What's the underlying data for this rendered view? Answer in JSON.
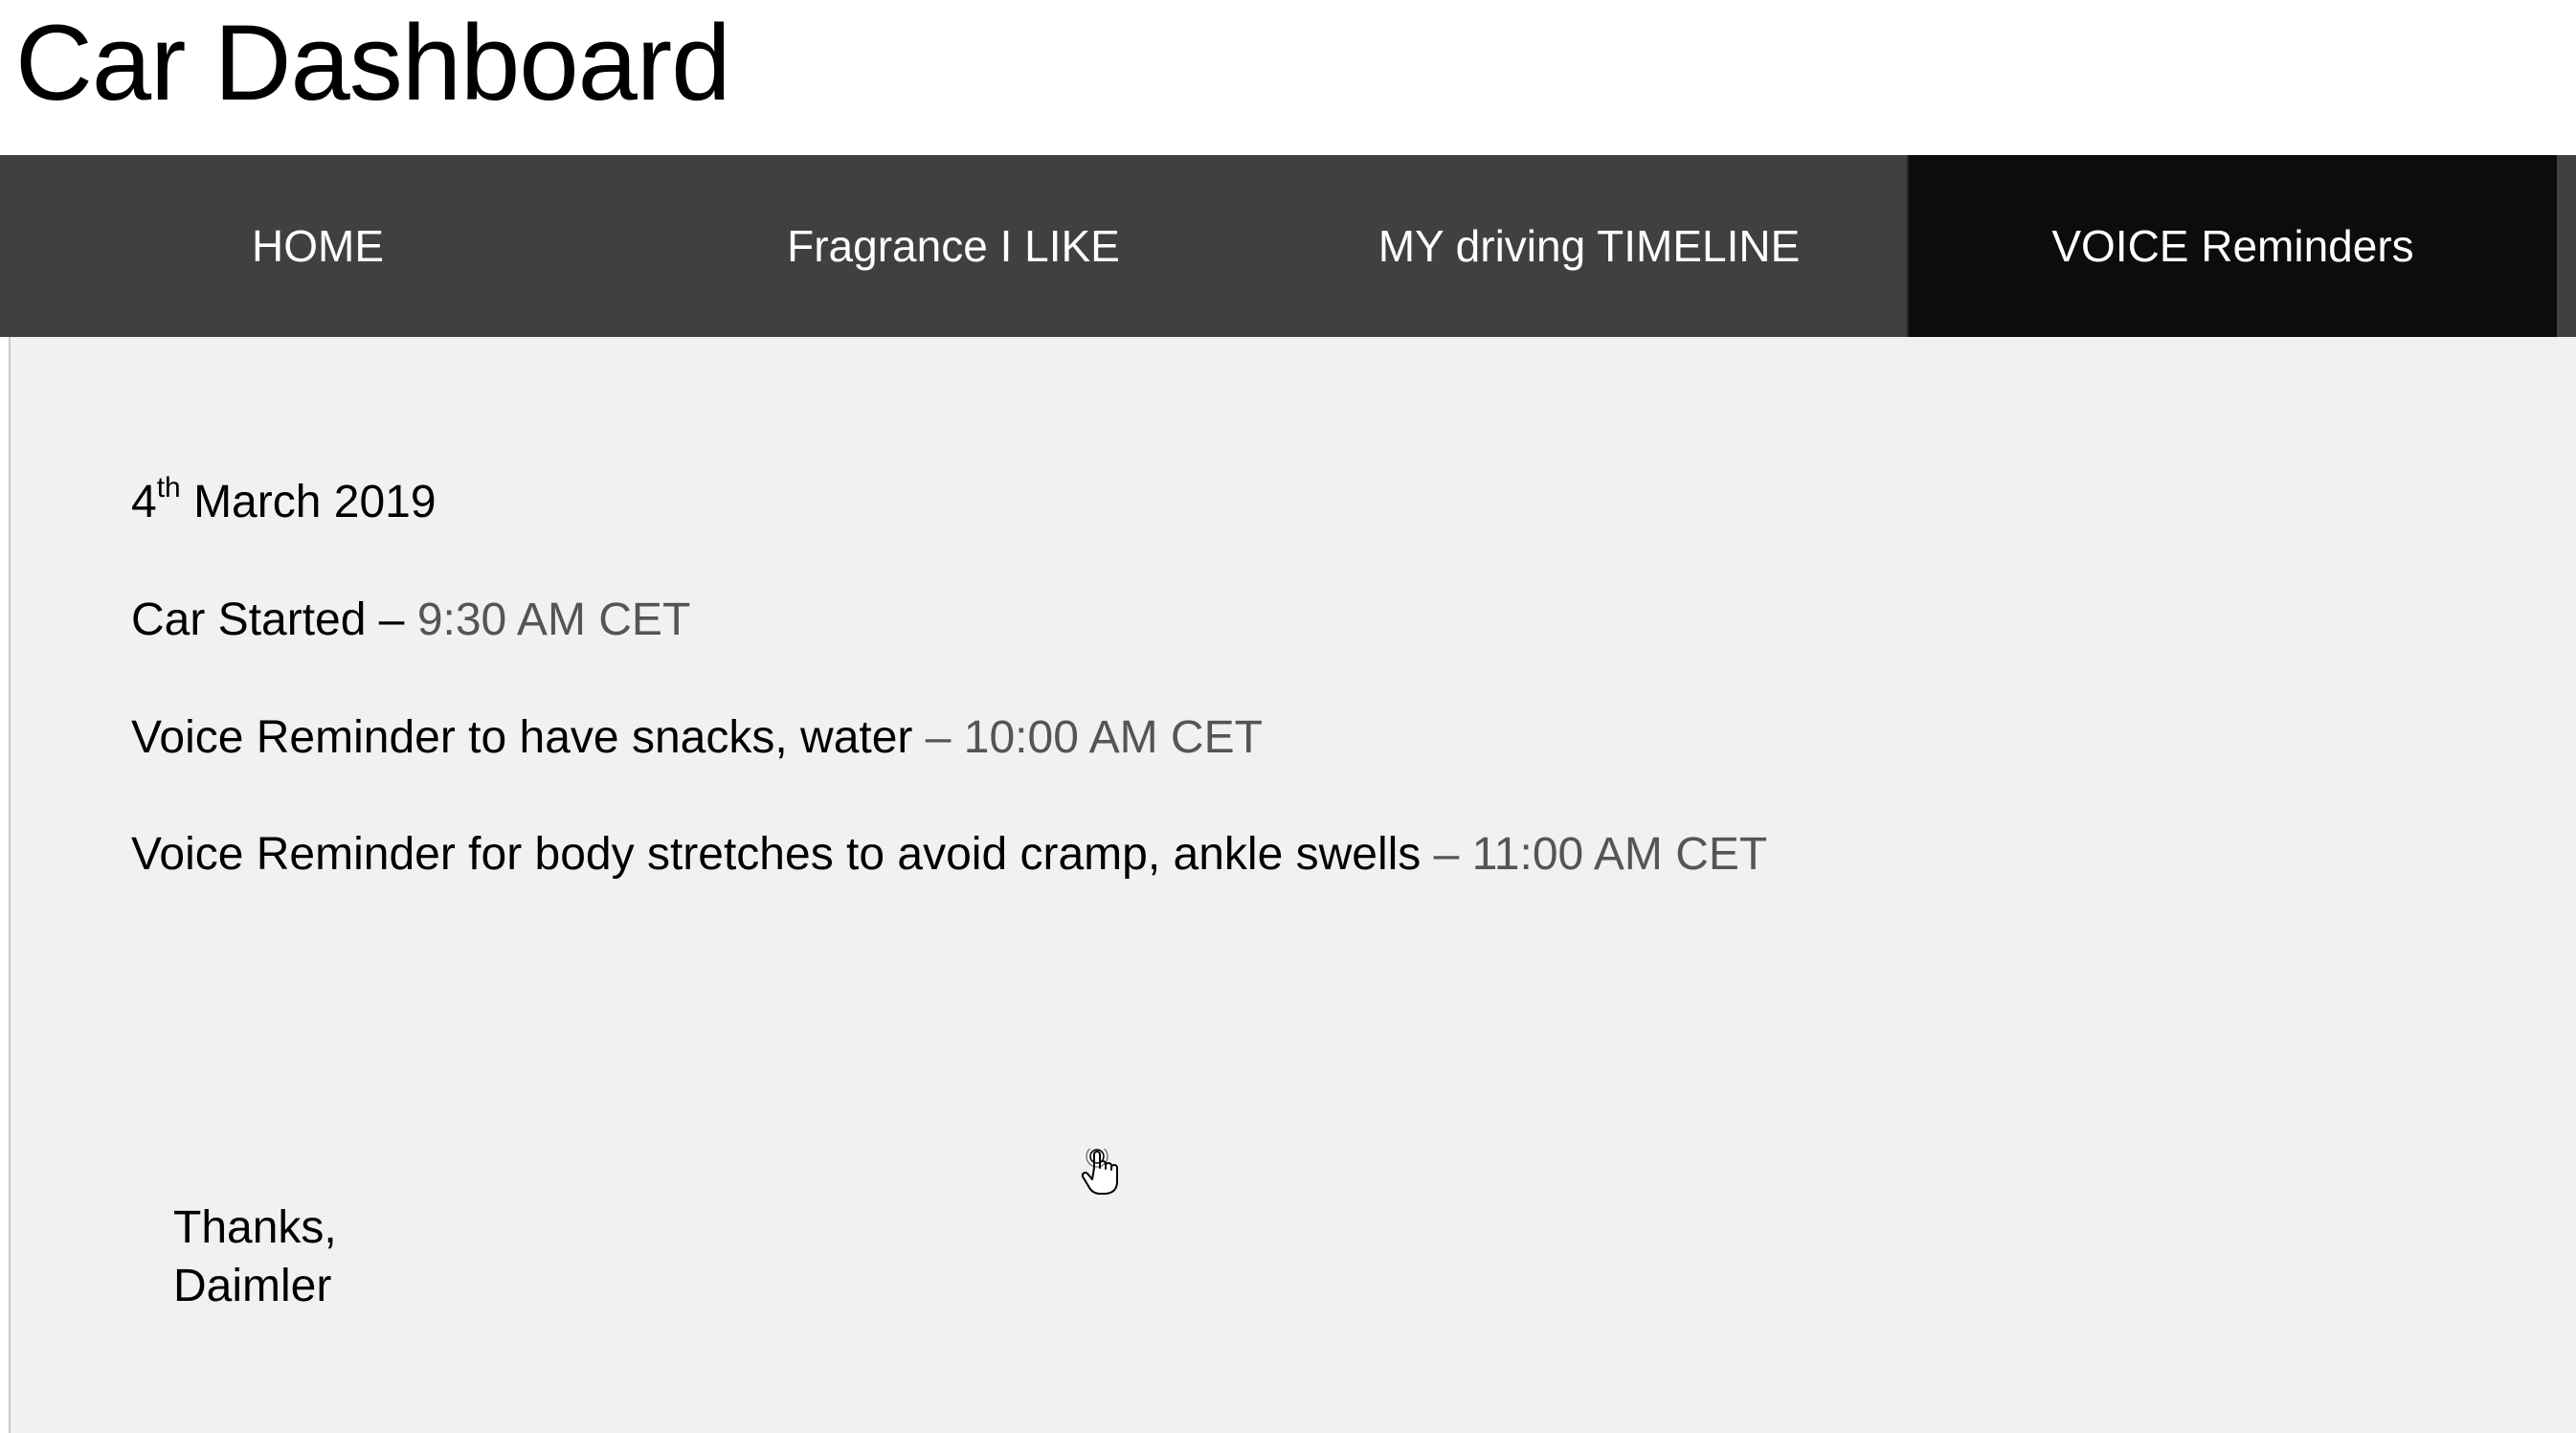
{
  "app": {
    "title": "Car Dashboard"
  },
  "nav": {
    "items": [
      {
        "label": "HOME"
      },
      {
        "label": "Fragrance I LIKE"
      },
      {
        "label": "MY driving TIMELINE"
      },
      {
        "label": "VOICE Reminders"
      }
    ],
    "active_index": 3
  },
  "reminders": {
    "date": {
      "day": "4",
      "suffix": "th",
      "rest": " March 2019"
    },
    "entries": [
      {
        "text": "Car Started – ",
        "time": "9:30 AM CET"
      },
      {
        "text": "Voice Reminder to have snacks, water ",
        "time": "– 10:00 AM CET"
      },
      {
        "text": "Voice Reminder for body stretches to avoid cramp, ankle swells ",
        "time": "– 11:00 AM CET"
      }
    ],
    "signoff": {
      "line1": "Thanks,",
      "line2": "Daimler"
    }
  },
  "colors": {
    "nav_bg": "#404040",
    "nav_active_bg": "#0c0c0c",
    "content_bg": "#f1f1f1",
    "time_text": "#555555"
  },
  "icons": {
    "cursor": "hand-pointer-icon"
  }
}
